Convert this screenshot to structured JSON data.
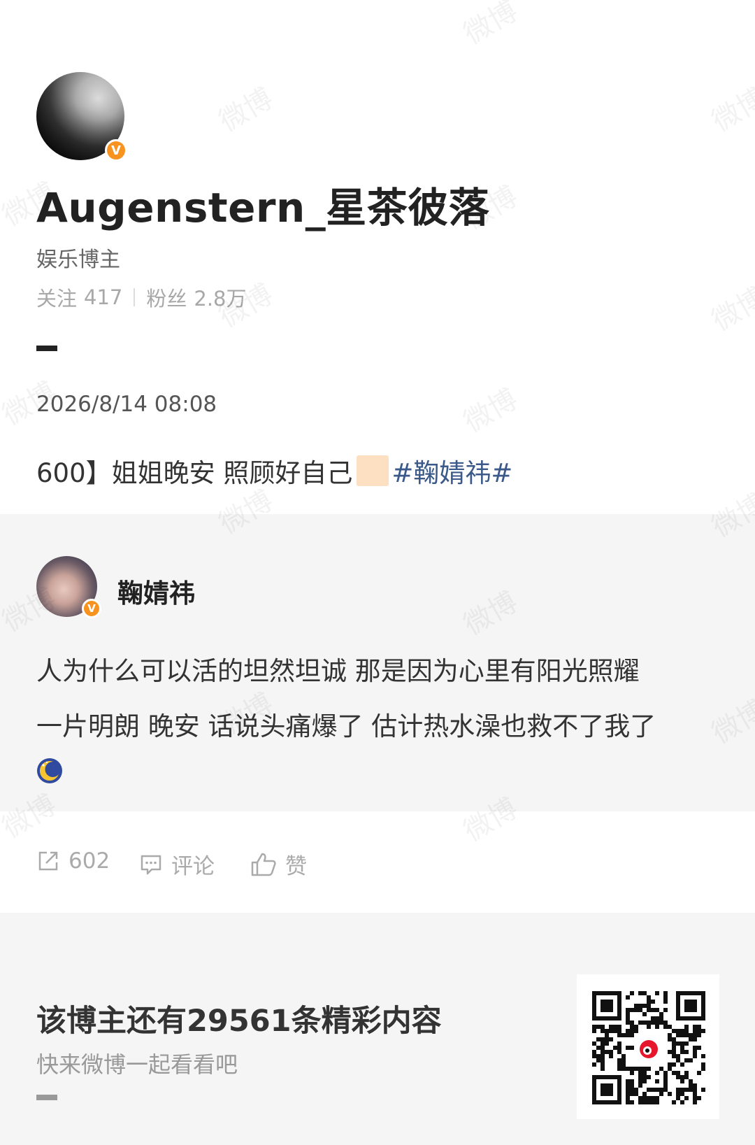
{
  "author": {
    "username": "Augenstern_星茶彼落",
    "role": "娱乐博主",
    "follow_label": "关注",
    "follow_count": "417",
    "fans_label": "粉丝",
    "fans_count": "2.8万",
    "verified_badge": "V"
  },
  "post": {
    "date": "2026/8/14 08:08",
    "text_prefix": "600】姐姐晚安 照顾好自己",
    "hashtag": "#鞠婧祎#"
  },
  "repost": {
    "name": "鞠婧祎",
    "verified_badge": "V",
    "lines": [
      "人为什么可以活的坦然坦诚 那是因为心里有阳光照耀",
      "一片明朗 晚安 话说头痛爆了 估计热水澡也救不了我了"
    ],
    "emoji_icon": "crescent-moon-emoji"
  },
  "actions": {
    "repost_count": "602",
    "comment_label": "评论",
    "like_label": "赞"
  },
  "footer": {
    "more_text": "该博主还有29561条精彩内容",
    "sub_text": "快来微博一起看看吧"
  },
  "colors": {
    "hashtag": "#3b5a8a",
    "badge": "#f7931e",
    "gray_bg": "#f5f5f5",
    "weibo_red": "#e6162d"
  }
}
